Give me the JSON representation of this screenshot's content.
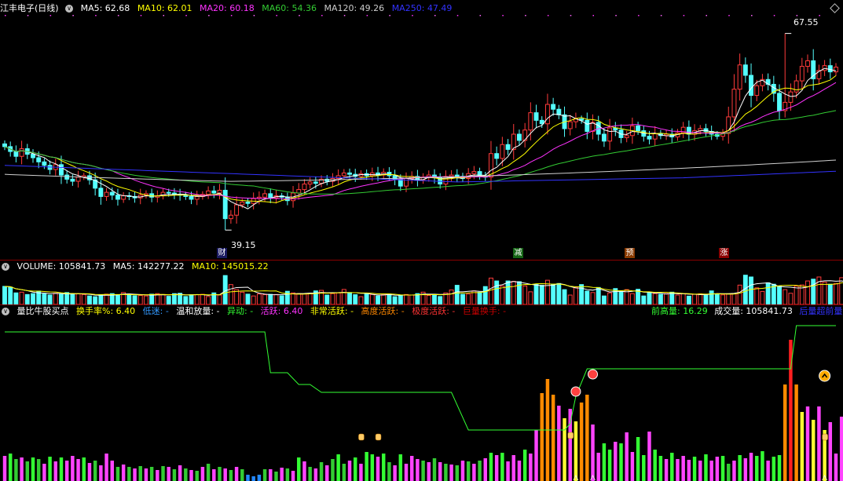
{
  "main": {
    "title": "江丰电子(日线)",
    "ma": [
      {
        "label": "MA5: 62.68",
        "color": "#ffffff"
      },
      {
        "label": "MA10: 62.01",
        "color": "#ffff00"
      },
      {
        "label": "MA20: 60.18",
        "color": "#ff33ff"
      },
      {
        "label": "MA60: 54.36",
        "color": "#33cc33"
      },
      {
        "label": "MA120: 49.26",
        "color": "#cccccc"
      },
      {
        "label": "MA250: 47.49",
        "color": "#3333ff"
      }
    ],
    "high_label": "67.55",
    "low_label": "39.15",
    "markers": [
      "财",
      "减",
      "预",
      "涨"
    ]
  },
  "volume": {
    "title": "VOLUME: 105841.73",
    "ma5": "MA5: 142277.22",
    "ma10": "MA10: 145015.22"
  },
  "indicator": {
    "name": "量比牛股买点",
    "items": [
      {
        "label": "换手率%: 6.40",
        "color": "#ffff00"
      },
      {
        "label": "低迷: -",
        "color": "#3399ff"
      },
      {
        "label": "温和放量: -",
        "color": "#ffffff"
      },
      {
        "label": "异动: -",
        "color": "#33ff33"
      },
      {
        "label": "活跃: 6.40",
        "color": "#ff33ff"
      },
      {
        "label": "非常活跃: -",
        "color": "#ffff00"
      },
      {
        "label": "高度活跃: -",
        "color": "#ff8800"
      },
      {
        "label": "极度活跃: -",
        "color": "#ff3333"
      },
      {
        "label": "巨量换手: -",
        "color": "#cc0000"
      }
    ],
    "right_items": [
      {
        "label": "前高量: 16.29",
        "color": "#33ff33"
      },
      {
        "label": "成交量: 105841.73",
        "color": "#ffffff"
      },
      {
        "label": "后量超前量",
        "color": "#3333ff"
      }
    ]
  },
  "chart_data": [
    {
      "type": "candlestick",
      "title": "江丰电子(日线)",
      "annotations": {
        "high": 67.55,
        "low": 39.15
      },
      "ma_latest": {
        "MA5": 62.68,
        "MA10": 62.01,
        "MA20": 60.18,
        "MA60": 54.36,
        "MA120": 49.26,
        "MA250": 47.49
      },
      "ylim": [
        36,
        70
      ],
      "close": [
        51.2,
        50.5,
        49.8,
        50.9,
        50.1,
        49.6,
        49.0,
        48.5,
        47.9,
        48.6,
        47.1,
        46.5,
        46.2,
        46.8,
        47.0,
        46.4,
        45.2,
        44.0,
        44.6,
        44.2,
        43.6,
        44.1,
        44.0,
        43.8,
        44.2,
        44.4,
        43.9,
        44.1,
        44.6,
        44.5,
        44.3,
        44.2,
        44.0,
        43.6,
        44.0,
        44.3,
        44.8,
        44.5,
        44.9,
        40.8,
        41.3,
        42.8,
        43.2,
        43.0,
        43.7,
        43.9,
        44.4,
        43.8,
        44.1,
        43.9,
        43.4,
        44.5,
        45.0,
        45.8,
        46.1,
        45.9,
        46.5,
        46.2,
        46.6,
        47.0,
        47.4,
        47.2,
        46.9,
        47.3,
        47.0,
        47.4,
        47.1,
        47.5,
        47.0,
        46.5,
        45.5,
        46.6,
        46.9,
        46.4,
        46.8,
        47.1,
        46.7,
        45.8,
        46.9,
        47.1,
        46.9,
        46.6,
        47.3,
        47.6,
        47.0,
        46.8,
        50.2,
        49.5,
        51.5,
        50.8,
        53.0,
        52.1,
        53.6,
        56.1,
        55.0,
        54.5,
        57.3,
        56.6,
        55.8,
        53.8,
        54.8,
        55.2,
        55.0,
        53.4,
        54.7,
        53.0,
        52.0,
        53.9,
        53.6,
        52.5,
        52.8,
        54.2,
        53.5,
        52.7,
        52.3,
        53.1,
        52.8,
        53.0,
        52.6,
        53.2,
        54.0,
        53.0,
        53.5,
        53.8,
        53.4,
        53.0,
        52.7,
        53.1,
        55.5,
        59.5,
        63.0,
        61.5,
        58.6,
        60.0,
        60.9,
        60.2,
        58.9,
        56.4,
        57.6,
        59.1,
        60.7,
        62.8,
        63.6,
        61.0,
        62.2,
        62.9,
        62.0,
        62.68
      ]
    },
    {
      "type": "bar",
      "title": "VOLUME: 105841.73",
      "series": [
        {
          "name": "MA5",
          "value": 142277.22
        },
        {
          "name": "MA10",
          "value": 145015.22
        }
      ],
      "values": [
        100,
        96,
        64,
        68,
        55,
        60,
        74,
        58,
        52,
        62,
        56,
        66,
        55,
        59,
        55,
        47,
        43,
        52,
        57,
        60,
        54,
        66,
        55,
        48,
        50,
        47,
        57,
        60,
        55,
        45,
        60,
        62,
        44,
        54,
        54,
        56,
        44,
        64,
        52,
        160,
        110,
        82,
        68,
        57,
        47,
        58,
        54,
        56,
        55,
        48,
        73,
        64,
        60,
        58,
        60,
        75,
        78,
        52,
        60,
        64,
        83,
        66,
        54,
        43,
        62,
        55,
        47,
        54,
        58,
        43,
        52,
        55,
        52,
        60,
        68,
        50,
        56,
        44,
        64,
        80,
        106,
        56,
        58,
        75,
        68,
        99,
        146,
        130,
        102,
        130,
        128,
        126,
        102,
        70,
        111,
        106,
        134,
        112,
        116,
        82,
        52,
        93,
        110,
        74,
        66,
        94,
        47,
        64,
        88,
        70,
        82,
        60,
        84,
        47,
        64,
        60,
        56,
        60,
        68,
        52,
        59,
        46,
        56,
        59,
        52,
        75,
        59,
        53,
        59,
        60,
        107,
        162,
        152,
        92,
        72,
        120,
        112,
        101,
        82,
        62,
        102,
        108,
        130,
        140,
        152,
        124,
        112,
        116,
        148,
        120,
        106
      ]
    },
    {
      "type": "bar",
      "title": "量比牛股买点",
      "values": [
        3.2,
        3.5,
        2.8,
        3.0,
        2.5,
        3.0,
        2.8,
        2.2,
        3.1,
        2.5,
        3.0,
        2.6,
        3.2,
        2.8,
        3.0,
        2.3,
        2.6,
        2.0,
        3.5,
        2.6,
        1.8,
        2.1,
        1.8,
        1.6,
        1.9,
        1.6,
        1.8,
        1.4,
        1.9,
        1.8,
        1.5,
        2.0,
        1.6,
        1.4,
        1.3,
        1.8,
        2.2,
        1.5,
        1.8,
        1.6,
        1.4,
        1.8,
        1.5,
        0.8,
        0.6,
        0.8,
        1.5,
        1.5,
        1.2,
        1.7,
        1.6,
        1.3,
        3.0,
        2.5,
        1.8,
        1.6,
        2.4,
        2.0,
        2.8,
        3.4,
        2.2,
        2.6,
        3.0,
        2.2,
        3.7,
        3.4,
        3.1,
        3.5,
        2.4,
        2.0,
        3.4,
        2.2,
        3.2,
        2.8,
        2.6,
        2.4,
        2.9,
        2.4,
        2.2,
        2.1,
        2.0,
        2.6,
        2.5,
        2.2,
        2.6,
        2.9,
        3.6,
        3.3,
        3.6,
        2.5,
        3.3,
        2.6,
        4.0,
        3.5,
        6.5,
        11.2,
        13.0,
        11.0,
        9.6,
        8.0,
        9.2,
        7.6,
        10.0,
        11.0,
        7.2,
        3.6,
        4.8,
        4.0,
        5.0,
        4.8,
        6.2,
        3.7,
        5.6,
        3.3,
        6.3,
        4.0,
        3.2,
        2.8,
        3.6,
        2.8,
        3.2,
        2.7,
        3.1,
        2.6,
        3.4,
        2.6,
        3.1,
        3.2,
        2.2,
        2.6,
        3.3,
        2.9,
        3.6,
        3.2,
        3.8,
        2.6,
        3.1,
        3.3,
        12.3,
        18.0,
        12.3,
        8.8,
        9.5,
        7.8,
        9.5,
        6.5,
        7.5,
        3.5,
        8.2,
        16.3,
        14.4,
        10.5,
        12.2,
        6.5,
        13.5,
        12.0,
        13.5,
        7.4
      ]
    }
  ],
  "icons": [
    "diamond-icon",
    "circle-toggle-icon",
    "hand-pointer-icon",
    "buy-signal-icon"
  ]
}
